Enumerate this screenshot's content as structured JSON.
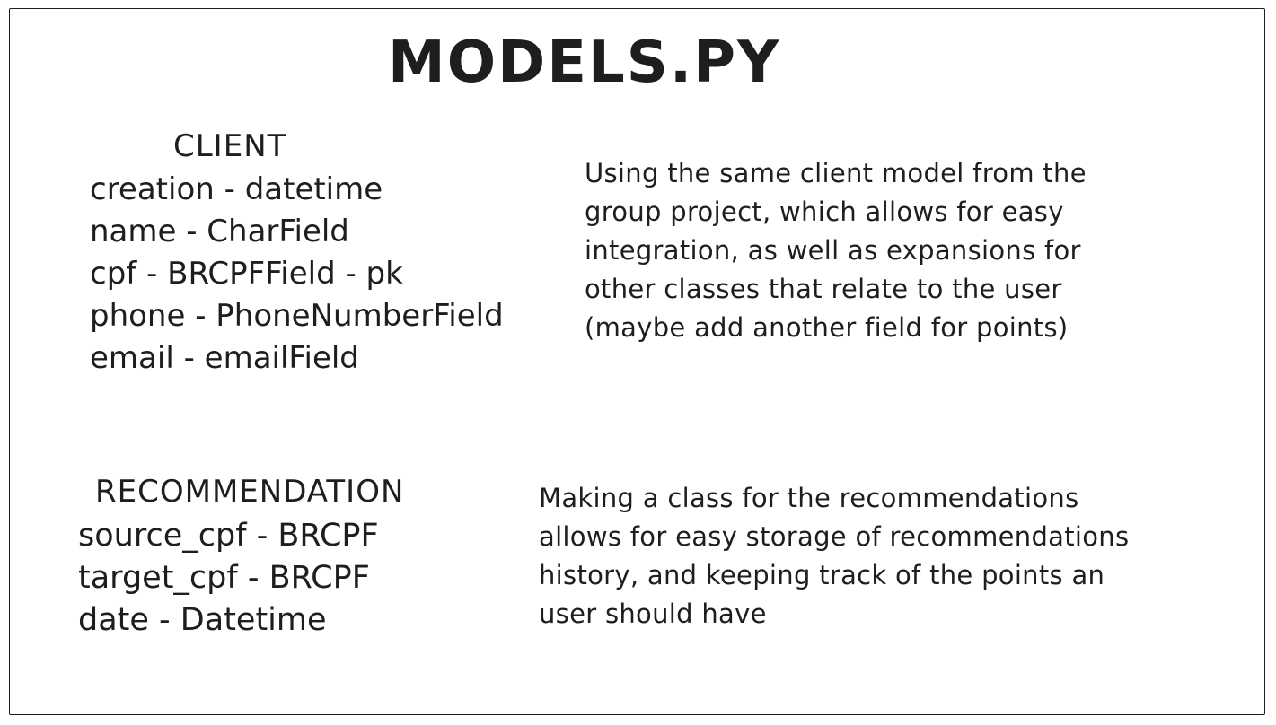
{
  "title": "MODELS.PY",
  "models": [
    {
      "name": "CLIENT",
      "fields": [
        "creation - datetime",
        "name - CharField",
        "cpf - BRCPFField - pk",
        "phone - PhoneNumberField",
        "email - emailField"
      ],
      "note_lines": [
        "Using the same client model from the",
        "group project, which allows for easy",
        "integration, as well as expansions for",
        "other classes that relate to the user",
        "(maybe add another field for points)"
      ]
    },
    {
      "name": "RECOMMENDATION",
      "fields": [
        "source_cpf - BRCPF",
        "target_cpf - BRCPF",
        "date - Datetime"
      ],
      "note_lines": [
        "Making a class for the recommendations",
        "allows for easy storage of recommendations",
        "history, and keeping track of the points an",
        "user should have"
      ]
    }
  ],
  "colors": {
    "ink": "#1e1e1e",
    "background": "#ffffff"
  }
}
